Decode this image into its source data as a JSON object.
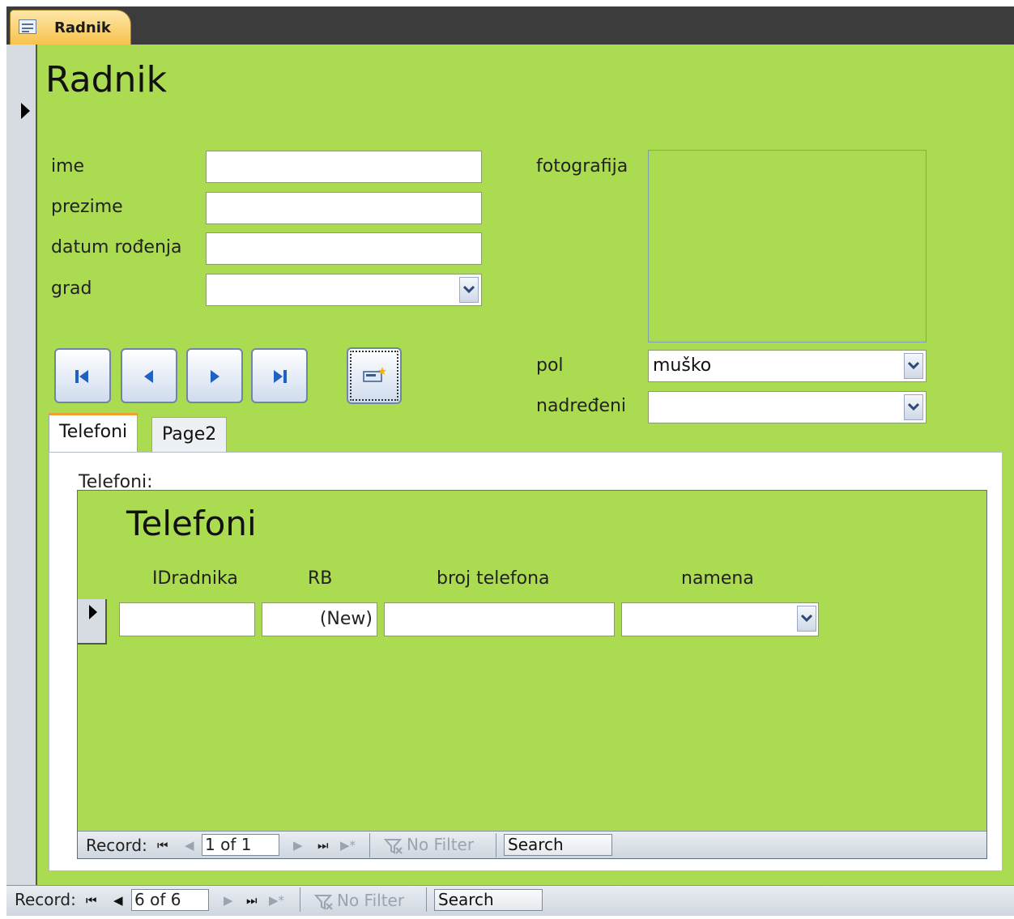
{
  "window": {
    "tab_title": "Radnik"
  },
  "form": {
    "title": "Radnik",
    "fields": {
      "ime_label": "ime",
      "prezime_label": "prezime",
      "datum_label": "datum rođenja",
      "grad_label": "grad",
      "foto_label": "fotografija",
      "pol_label": "pol",
      "pol_value": "muško",
      "nadredjeni_label": "nadređeni"
    },
    "tabs": [
      {
        "label": "Telefoni"
      },
      {
        "label": "Page2"
      }
    ]
  },
  "subform": {
    "caption": "Telefoni:",
    "title": "Telefoni",
    "columns": [
      "IDradnika",
      "RB",
      "broj telefona",
      "namena"
    ],
    "new_row": {
      "rb": "(New)"
    },
    "record_bar": {
      "label": "Record:",
      "position": "1 of 1",
      "filter": "No Filter",
      "search": "Search"
    }
  },
  "record_bar": {
    "label": "Record:",
    "position": "6 of 6",
    "filter": "No Filter",
    "search": "Search"
  },
  "colors": {
    "form_bg": "#abdb50",
    "tab_accent": "#f7c24d"
  },
  "icons": [
    "first-record-icon",
    "previous-record-icon",
    "next-record-icon",
    "last-record-icon",
    "new-record-icon",
    "dropdown-arrow-icon",
    "filter-icon"
  ]
}
